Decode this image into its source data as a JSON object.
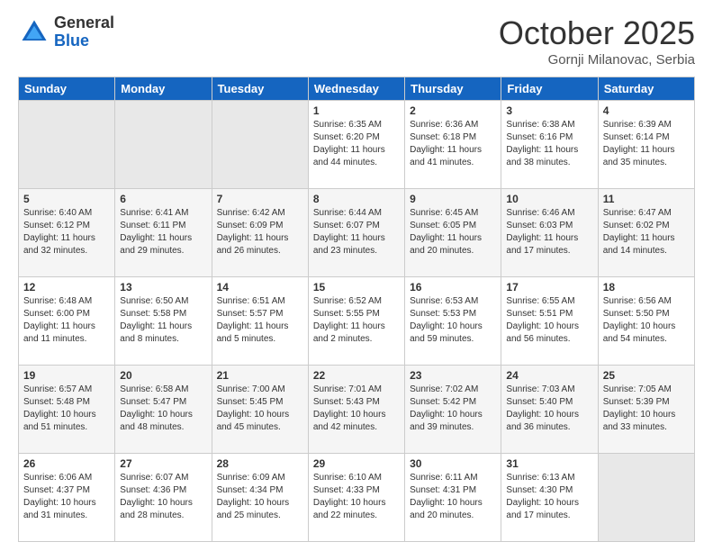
{
  "header": {
    "logo_general": "General",
    "logo_blue": "Blue",
    "month_title": "October 2025",
    "location": "Gornji Milanovac, Serbia"
  },
  "days_of_week": [
    "Sunday",
    "Monday",
    "Tuesday",
    "Wednesday",
    "Thursday",
    "Friday",
    "Saturday"
  ],
  "weeks": [
    [
      {
        "day": "",
        "sunrise": "",
        "sunset": "",
        "daylight": ""
      },
      {
        "day": "",
        "sunrise": "",
        "sunset": "",
        "daylight": ""
      },
      {
        "day": "",
        "sunrise": "",
        "sunset": "",
        "daylight": ""
      },
      {
        "day": "1",
        "sunrise": "Sunrise: 6:35 AM",
        "sunset": "Sunset: 6:20 PM",
        "daylight": "Daylight: 11 hours and 44 minutes."
      },
      {
        "day": "2",
        "sunrise": "Sunrise: 6:36 AM",
        "sunset": "Sunset: 6:18 PM",
        "daylight": "Daylight: 11 hours and 41 minutes."
      },
      {
        "day": "3",
        "sunrise": "Sunrise: 6:38 AM",
        "sunset": "Sunset: 6:16 PM",
        "daylight": "Daylight: 11 hours and 38 minutes."
      },
      {
        "day": "4",
        "sunrise": "Sunrise: 6:39 AM",
        "sunset": "Sunset: 6:14 PM",
        "daylight": "Daylight: 11 hours and 35 minutes."
      }
    ],
    [
      {
        "day": "5",
        "sunrise": "Sunrise: 6:40 AM",
        "sunset": "Sunset: 6:12 PM",
        "daylight": "Daylight: 11 hours and 32 minutes."
      },
      {
        "day": "6",
        "sunrise": "Sunrise: 6:41 AM",
        "sunset": "Sunset: 6:11 PM",
        "daylight": "Daylight: 11 hours and 29 minutes."
      },
      {
        "day": "7",
        "sunrise": "Sunrise: 6:42 AM",
        "sunset": "Sunset: 6:09 PM",
        "daylight": "Daylight: 11 hours and 26 minutes."
      },
      {
        "day": "8",
        "sunrise": "Sunrise: 6:44 AM",
        "sunset": "Sunset: 6:07 PM",
        "daylight": "Daylight: 11 hours and 23 minutes."
      },
      {
        "day": "9",
        "sunrise": "Sunrise: 6:45 AM",
        "sunset": "Sunset: 6:05 PM",
        "daylight": "Daylight: 11 hours and 20 minutes."
      },
      {
        "day": "10",
        "sunrise": "Sunrise: 6:46 AM",
        "sunset": "Sunset: 6:03 PM",
        "daylight": "Daylight: 11 hours and 17 minutes."
      },
      {
        "day": "11",
        "sunrise": "Sunrise: 6:47 AM",
        "sunset": "Sunset: 6:02 PM",
        "daylight": "Daylight: 11 hours and 14 minutes."
      }
    ],
    [
      {
        "day": "12",
        "sunrise": "Sunrise: 6:48 AM",
        "sunset": "Sunset: 6:00 PM",
        "daylight": "Daylight: 11 hours and 11 minutes."
      },
      {
        "day": "13",
        "sunrise": "Sunrise: 6:50 AM",
        "sunset": "Sunset: 5:58 PM",
        "daylight": "Daylight: 11 hours and 8 minutes."
      },
      {
        "day": "14",
        "sunrise": "Sunrise: 6:51 AM",
        "sunset": "Sunset: 5:57 PM",
        "daylight": "Daylight: 11 hours and 5 minutes."
      },
      {
        "day": "15",
        "sunrise": "Sunrise: 6:52 AM",
        "sunset": "Sunset: 5:55 PM",
        "daylight": "Daylight: 11 hours and 2 minutes."
      },
      {
        "day": "16",
        "sunrise": "Sunrise: 6:53 AM",
        "sunset": "Sunset: 5:53 PM",
        "daylight": "Daylight: 10 hours and 59 minutes."
      },
      {
        "day": "17",
        "sunrise": "Sunrise: 6:55 AM",
        "sunset": "Sunset: 5:51 PM",
        "daylight": "Daylight: 10 hours and 56 minutes."
      },
      {
        "day": "18",
        "sunrise": "Sunrise: 6:56 AM",
        "sunset": "Sunset: 5:50 PM",
        "daylight": "Daylight: 10 hours and 54 minutes."
      }
    ],
    [
      {
        "day": "19",
        "sunrise": "Sunrise: 6:57 AM",
        "sunset": "Sunset: 5:48 PM",
        "daylight": "Daylight: 10 hours and 51 minutes."
      },
      {
        "day": "20",
        "sunrise": "Sunrise: 6:58 AM",
        "sunset": "Sunset: 5:47 PM",
        "daylight": "Daylight: 10 hours and 48 minutes."
      },
      {
        "day": "21",
        "sunrise": "Sunrise: 7:00 AM",
        "sunset": "Sunset: 5:45 PM",
        "daylight": "Daylight: 10 hours and 45 minutes."
      },
      {
        "day": "22",
        "sunrise": "Sunrise: 7:01 AM",
        "sunset": "Sunset: 5:43 PM",
        "daylight": "Daylight: 10 hours and 42 minutes."
      },
      {
        "day": "23",
        "sunrise": "Sunrise: 7:02 AM",
        "sunset": "Sunset: 5:42 PM",
        "daylight": "Daylight: 10 hours and 39 minutes."
      },
      {
        "day": "24",
        "sunrise": "Sunrise: 7:03 AM",
        "sunset": "Sunset: 5:40 PM",
        "daylight": "Daylight: 10 hours and 36 minutes."
      },
      {
        "day": "25",
        "sunrise": "Sunrise: 7:05 AM",
        "sunset": "Sunset: 5:39 PM",
        "daylight": "Daylight: 10 hours and 33 minutes."
      }
    ],
    [
      {
        "day": "26",
        "sunrise": "Sunrise: 6:06 AM",
        "sunset": "Sunset: 4:37 PM",
        "daylight": "Daylight: 10 hours and 31 minutes."
      },
      {
        "day": "27",
        "sunrise": "Sunrise: 6:07 AM",
        "sunset": "Sunset: 4:36 PM",
        "daylight": "Daylight: 10 hours and 28 minutes."
      },
      {
        "day": "28",
        "sunrise": "Sunrise: 6:09 AM",
        "sunset": "Sunset: 4:34 PM",
        "daylight": "Daylight: 10 hours and 25 minutes."
      },
      {
        "day": "29",
        "sunrise": "Sunrise: 6:10 AM",
        "sunset": "Sunset: 4:33 PM",
        "daylight": "Daylight: 10 hours and 22 minutes."
      },
      {
        "day": "30",
        "sunrise": "Sunrise: 6:11 AM",
        "sunset": "Sunset: 4:31 PM",
        "daylight": "Daylight: 10 hours and 20 minutes."
      },
      {
        "day": "31",
        "sunrise": "Sunrise: 6:13 AM",
        "sunset": "Sunset: 4:30 PM",
        "daylight": "Daylight: 10 hours and 17 minutes."
      },
      {
        "day": "",
        "sunrise": "",
        "sunset": "",
        "daylight": ""
      }
    ]
  ]
}
